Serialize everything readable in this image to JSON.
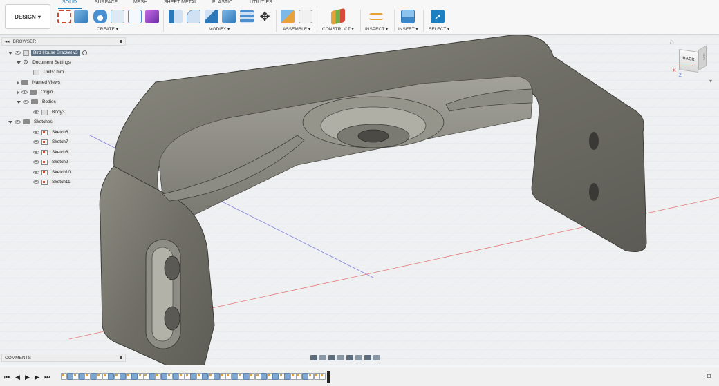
{
  "toolbar": {
    "workspace_button": "DESIGN",
    "tabs": [
      "SOLID",
      "SURFACE",
      "MESH",
      "SHEET METAL",
      "PLASTIC",
      "UTILITIES"
    ],
    "groups": [
      "CREATE",
      "MODIFY",
      "ASSEMBLE",
      "CONSTRUCT",
      "INSPECT",
      "INSERT",
      "SELECT"
    ],
    "accent": "#1c7fc1"
  },
  "browser": {
    "title": "BROWSER",
    "root": "Bird House Bracket v3",
    "items": [
      {
        "label": "Document Settings"
      },
      {
        "label": "Units: mm"
      },
      {
        "label": "Named Views"
      },
      {
        "label": "Origin"
      },
      {
        "label": "Bodies"
      },
      {
        "label": "Body3"
      },
      {
        "label": "Sketches"
      },
      {
        "label": "Sketch6"
      },
      {
        "label": "Sketch7"
      },
      {
        "label": "Sketch8"
      },
      {
        "label": "Sketch9"
      },
      {
        "label": "Sketch10"
      },
      {
        "label": "Sketch11"
      }
    ]
  },
  "viewcube": {
    "face_label": "BACK",
    "side_label": "LEFT",
    "axis_x": "X",
    "axis_z": "Z"
  },
  "comments": {
    "title": "COMMENTS"
  },
  "timeline": {
    "items": [
      "sk",
      "ft",
      "sk",
      "ft",
      "sk",
      "ft",
      "sk",
      "sk",
      "ft",
      "sk",
      "ft",
      "sk",
      "ft",
      "sk",
      "sk",
      "ft",
      "sk",
      "ft",
      "sk",
      "ft",
      "sk",
      "sk",
      "ft",
      "sk",
      "ft",
      "sk",
      "ft",
      "sk",
      "sk",
      "ft",
      "sk",
      "ft",
      "sk",
      "sk",
      "ft",
      "sk",
      "ft",
      "sk",
      "ft",
      "sk",
      "sk",
      "ft",
      "sk",
      "sk",
      "sk"
    ]
  }
}
